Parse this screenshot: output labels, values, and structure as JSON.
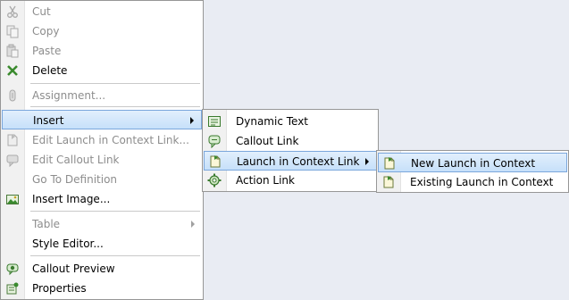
{
  "context_menu": {
    "cut": "Cut",
    "copy": "Copy",
    "paste": "Paste",
    "delete": "Delete",
    "assignment": "Assignment...",
    "insert": "Insert",
    "edit_launch": "Edit Launch in Context Link...",
    "edit_callout": "Edit Callout Link",
    "go_to_definition": "Go To Definition",
    "insert_image": "Insert Image...",
    "table": "Table",
    "style_editor": "Style Editor...",
    "callout_preview": "Callout Preview",
    "properties": "Properties"
  },
  "insert_submenu": {
    "dynamic_text": "Dynamic Text",
    "callout_link": "Callout Link",
    "launch_in_context_link": "Launch in Context Link",
    "action_link": "Action Link"
  },
  "launch_submenu": {
    "new_launch": "New Launch in Context",
    "existing_launch": "Existing Launch in Context"
  },
  "icons": {
    "cut": "scissors-icon",
    "copy": "copy-icon",
    "paste": "paste-icon",
    "delete": "delete-x-icon",
    "assignment": "assignment-icon",
    "edit_launch": "edit-launch-icon",
    "edit_callout": "edit-callout-icon",
    "insert_image": "image-icon",
    "callout_preview": "eye-icon",
    "properties": "properties-icon",
    "dynamic_text": "text-field-icon",
    "callout_link": "callout-icon",
    "launch_in_context_link": "document-icon",
    "action_link": "gear-icon"
  },
  "colors": {
    "highlight_border": "#7ba7dc",
    "highlight_fill": "#c6e0fa",
    "disabled_text": "#8d8d8d",
    "desktop_background": "#e9ecf3"
  }
}
